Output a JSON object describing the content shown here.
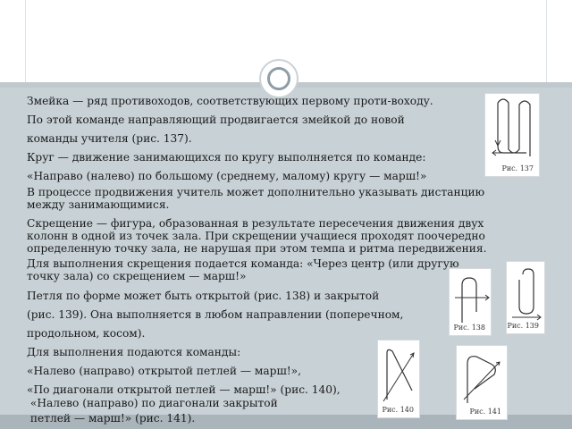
{
  "lines": [
    "Змейка — ряд противоходов, соответствующих первому проти-воходу.",
    "По этой команде направляющий продвигается змейкой до новой",
    "команды учителя (рис. 137).",
    "Круг — движение занимающихся по кругу выполняется по команде:",
    "«Направо (налево) по большому (среднему, малому) кругу — марш!»",
    "В процессе продвижения учитель может дополнительно указывать дистанцию",
    "между занимающимися.",
    "Скрещение — фигура, образованная в результате пересечения движения двух",
    "колонн в одной из точек зала. При скрещении учащиеся проходят поочередно",
    "определенную точку зала, не нарушая при этом темпа и ритма передвижения.",
    "Для выполнения скрещения подается команда: «Через центр (или другую",
    "точку зала) со скрещением — марш!»",
    "Петля по форме может быть открытой (рис. 138) и закрытой",
    "(рис. 139).   Она выполняется в любом направлении (поперечном,",
    "продольном, косом).",
    "Для выполнения подаются команды:",
    "«Налево (направо) открытой петлей — марш!»,",
    "«По диагонали открытой петлей — марш!» (рис. 140),",
    " «Налево (направо) по диагонали закрытой",
    " петлей — марш!» (рис. 141)."
  ],
  "figures": {
    "fig137": "Рис. 137",
    "fig138": "Рис. 138",
    "fig139": "Рис. 139",
    "fig140": "Рис. 140",
    "fig141": "Рис. 141"
  }
}
